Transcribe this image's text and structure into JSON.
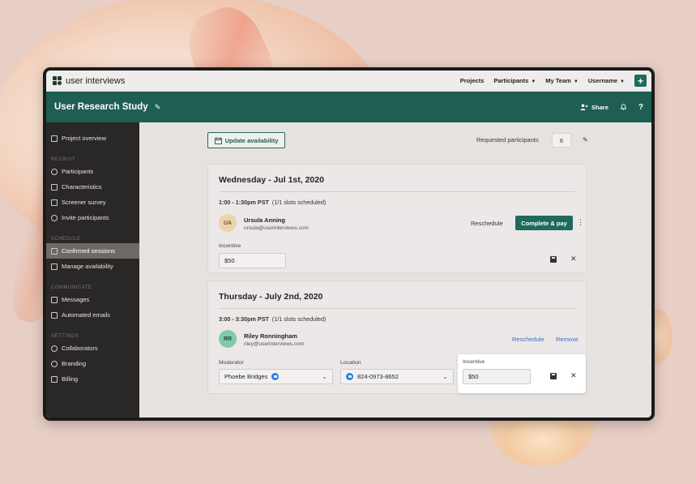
{
  "nav": {
    "logo_text": "user interviews",
    "items": [
      "Projects",
      "Participants",
      "My Team",
      "Username"
    ],
    "plus_label": "+"
  },
  "header": {
    "title": "User Research Study",
    "share_label": "Share",
    "help_label": "?"
  },
  "sidebar": {
    "top_item": "Project overview",
    "sections": [
      {
        "label": "RECRUIT",
        "items": [
          "Participants",
          "Characteristics",
          "Screener survey",
          "Invite participants"
        ]
      },
      {
        "label": "SCHEDULE",
        "items": [
          "Confirmed sessions",
          "Manage availability"
        ]
      },
      {
        "label": "COMMUNICATE",
        "items": [
          "Messages",
          "Automated emails"
        ]
      },
      {
        "label": "SETTINGS",
        "items": [
          "Collaborators",
          "Branding",
          "Billing"
        ]
      }
    ],
    "active_item": "Confirmed sessions"
  },
  "main": {
    "update_button": "Update availability",
    "requested_label": "Requested participants",
    "requested_value": "6",
    "sessions": [
      {
        "date": "Wednesday - Jul 1st, 2020",
        "time": "1:00 - 1:30pm PST",
        "slots": "(1/1 slots scheduled)",
        "initials": "UA",
        "name": "Ursula Anning",
        "email": "ursula@userinterviews.com",
        "reschedule": "Reschedule",
        "action": "Complete & pay",
        "incentive_label": "Incentive",
        "incentive_value": "$50"
      },
      {
        "date": "Thursday - July 2nd, 2020",
        "time": "3:00 - 3:30pm PST",
        "slots": "(1/1 slots scheduled)",
        "initials": "RR",
        "name": "Riley Ronningham",
        "email": "riley@userinterviews.com",
        "reschedule": "Reschedule",
        "remove": "Remove",
        "moderator_label": "Moderator",
        "moderator_value": "Phoebe Bridges",
        "location_label": "Location",
        "location_value": "824-0973-8652",
        "incentive_label": "Incentive",
        "incentive_value": "$50"
      }
    ]
  },
  "colors": {
    "brand_green": "#1e5e53",
    "button_green": "#1e6b5d",
    "sidebar_bg": "#2a2727",
    "link_blue": "#3b6fc0"
  }
}
